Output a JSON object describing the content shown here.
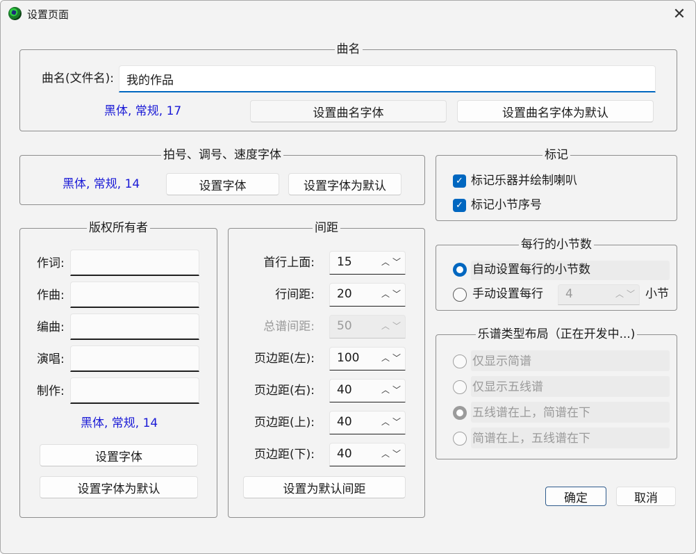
{
  "window": {
    "title": "设置页面",
    "close_symbol": "✕"
  },
  "song_name": {
    "legend": "曲名",
    "label": "曲名(文件名):",
    "value": "我的作品",
    "font_info": "黑体, 常规, 17",
    "set_font_button": "设置曲名字体",
    "set_default_button": "设置曲名字体为默认"
  },
  "beat_font": {
    "legend": "拍号、调号、速度字体",
    "font_info": "黑体, 常规, 14",
    "set_font_button": "设置字体",
    "set_default_button": "设置字体为默认"
  },
  "copyright": {
    "legend": "版权所有者",
    "fields": [
      {
        "label": "作词:",
        "value": ""
      },
      {
        "label": "作曲:",
        "value": ""
      },
      {
        "label": "编曲:",
        "value": ""
      },
      {
        "label": "演唱:",
        "value": ""
      },
      {
        "label": "制作:",
        "value": ""
      }
    ],
    "font_info": "黑体, 常规, 14",
    "set_font_button": "设置字体",
    "set_default_button": "设置字体为默认"
  },
  "spacing": {
    "legend": "间距",
    "fields": [
      {
        "label": "首行上面:",
        "value": "15",
        "disabled": false
      },
      {
        "label": "行间距:",
        "value": "20",
        "disabled": false
      },
      {
        "label": "总谱间距:",
        "value": "50",
        "disabled": true
      },
      {
        "label": "页边距(左):",
        "value": "100",
        "disabled": false
      },
      {
        "label": "页边距(右):",
        "value": "40",
        "disabled": false
      },
      {
        "label": "页边距(上):",
        "value": "40",
        "disabled": false
      },
      {
        "label": "页边距(下):",
        "value": "40",
        "disabled": false
      }
    ],
    "default_button": "设置为默认间距"
  },
  "marks": {
    "legend": "标记",
    "options": [
      {
        "label": "标记乐器并绘制喇叭",
        "checked": true
      },
      {
        "label": "标记小节序号",
        "checked": true
      }
    ]
  },
  "bars_per_line": {
    "legend": "每行的小节数",
    "auto_label": "自动设置每行的小节数",
    "manual_label": "手动设置每行",
    "manual_value": "4",
    "unit": "小节",
    "selected": "auto"
  },
  "layout": {
    "legend": "乐谱类型布局（正在开发中...)",
    "options": [
      {
        "label": "仅显示简谱",
        "selected": false
      },
      {
        "label": "仅显示五线谱",
        "selected": false
      },
      {
        "label": "五线谱在上，简谱在下",
        "selected": true
      },
      {
        "label": "简谱在上，五线谱在下",
        "selected": false
      }
    ]
  },
  "footer": {
    "ok_button": "确定",
    "cancel_button": "取消"
  },
  "colors": {
    "accent": "#0067c0",
    "font_info": "#1a1ad6"
  }
}
